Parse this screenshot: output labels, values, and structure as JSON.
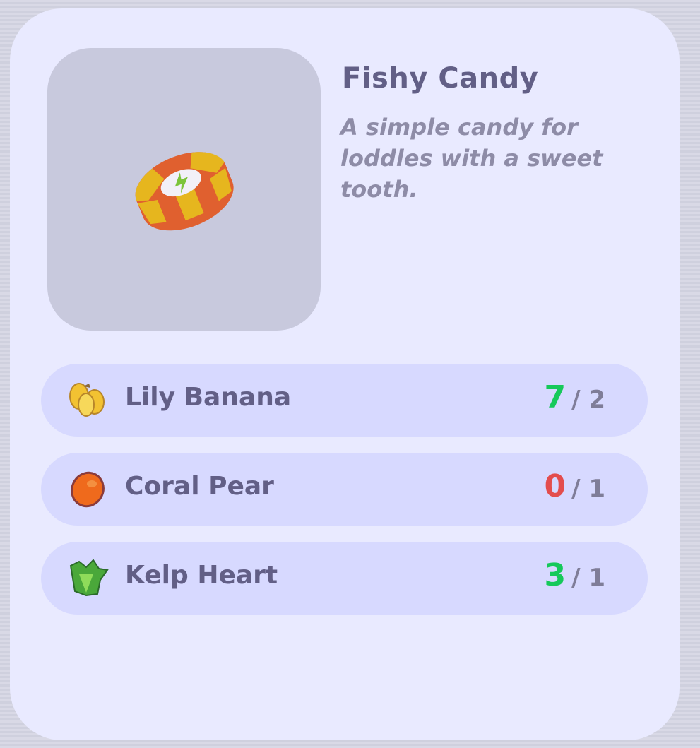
{
  "item": {
    "name": "Fishy Candy",
    "description": "A simple candy for loddles with a sweet tooth.",
    "image_icon": "candy-icon"
  },
  "ingredients": [
    {
      "name": "Lily Banana",
      "icon": "banana-icon",
      "have": "7",
      "need": "/ 2",
      "status_color": "#16c95a"
    },
    {
      "name": "Coral Pear",
      "icon": "pear-icon",
      "have": "0",
      "need": "/ 1",
      "status_color": "#e34d4d"
    },
    {
      "name": "Kelp Heart",
      "icon": "kelp-icon",
      "have": "3",
      "need": "/ 1",
      "status_color": "#16c95a"
    }
  ],
  "colors": {
    "panel": "#e9eaff",
    "row": "#d7d9ff",
    "title": "#625f86",
    "description": "#8e8ca7",
    "enough": "#16c95a",
    "missing": "#e34d4d"
  }
}
